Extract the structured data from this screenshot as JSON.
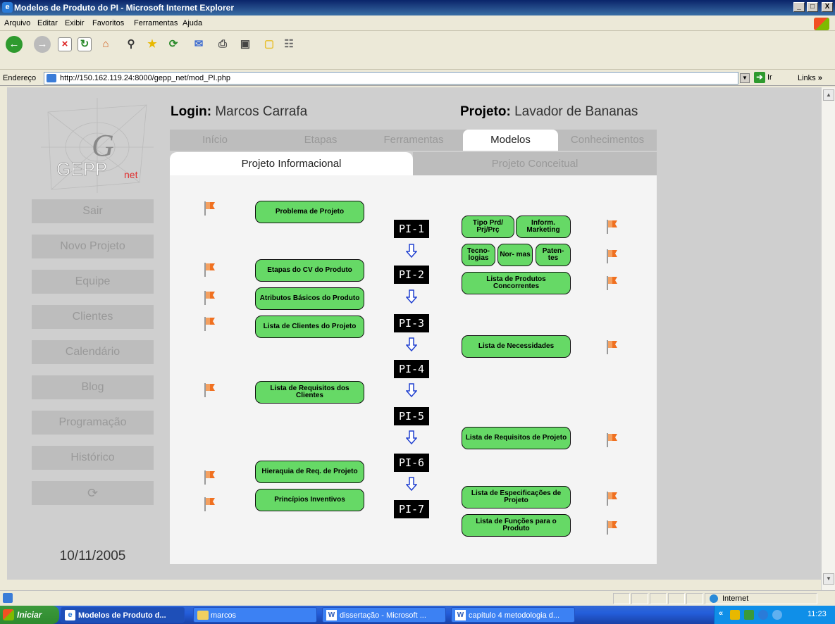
{
  "window": {
    "title": "Modelos de Produto do PI - Microsoft Internet Explorer",
    "min": "_",
    "max": "□",
    "close": "X"
  },
  "menu": [
    "Arquivo",
    "Editar",
    "Exibir",
    "Favoritos",
    "Ferramentas",
    "Ajuda"
  ],
  "address": {
    "label": "Endereço",
    "url": "http://150.162.119.24:8000/gepp_net/mod_PI.php",
    "go": "Ir",
    "links": "Links"
  },
  "logo": {
    "text": "GEPP",
    "sub": "net"
  },
  "header": {
    "login_label": "Login:",
    "login_value": "Marcos Carrafa",
    "project_label": "Projeto:",
    "project_value": "Lavador de Bananas"
  },
  "tabs": [
    "Início",
    "Etapas",
    "Ferramentas",
    "Modelos",
    "Conhecimentos"
  ],
  "subtabs": [
    "Projeto Informacional",
    "Projeto Conceitual"
  ],
  "sidebar": [
    "Sair",
    "Novo Projeto",
    "Equipe",
    "Clientes",
    "Calendário",
    "Blog",
    "Programação",
    "Histórico"
  ],
  "date": "10/11/2005",
  "phases": [
    "PI-1",
    "PI-2",
    "PI-3",
    "PI-4",
    "PI-5",
    "PI-6",
    "PI-7"
  ],
  "left_models": [
    "Problema de Projeto",
    "Etapas do CV do Produto",
    "Atributos Básicos do Produto",
    "Lista de Clientes do Projeto",
    "Lista de Requisitos dos Clientes",
    "Hieraquia de Req. de Projeto",
    "Princípios Inventivos"
  ],
  "right_models": [
    "Tipo Prd/ Prj/Prç",
    "Inform. Marketing",
    "Tecno- logias",
    "Nor- mas",
    "Paten- tes",
    "Lista de Produtos Concorrentes",
    "Lista de Necessidades",
    "Lista de Requisitos de Projeto",
    "Lista de Especificações de Projeto",
    "Lista de Funções para o Produto"
  ],
  "status": {
    "zone": "Internet"
  },
  "taskbar": {
    "start": "Iniciar",
    "tasks": [
      "Modelos de Produto d...",
      "marcos",
      "dissertação - Microsoft ...",
      "capítulo 4  metodologia d..."
    ],
    "clock": "11:23"
  },
  "colors": {
    "model_green": "#66d966",
    "tab_gray": "#bdbdbd",
    "panel": "#f4f4f4"
  }
}
